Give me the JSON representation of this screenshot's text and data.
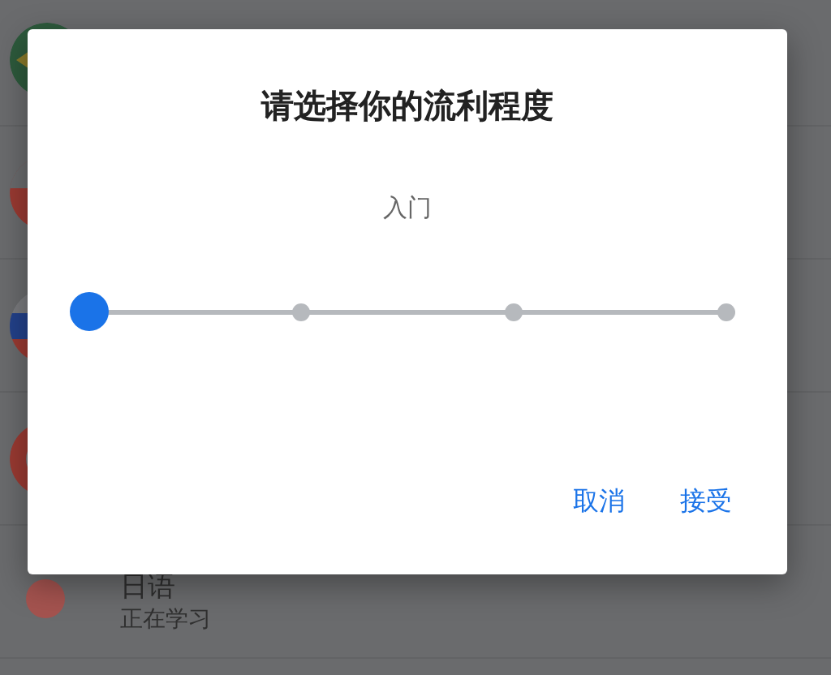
{
  "background_list": {
    "items": [
      {
        "name": "日语",
        "status": "正在学习"
      }
    ]
  },
  "dialog": {
    "title": "请选择你的流利程度",
    "level_label": "入门",
    "slider": {
      "level": 0
    },
    "buttons": [
      {
        "label": "取消"
      },
      {
        "label": "接受"
      }
    ]
  }
}
